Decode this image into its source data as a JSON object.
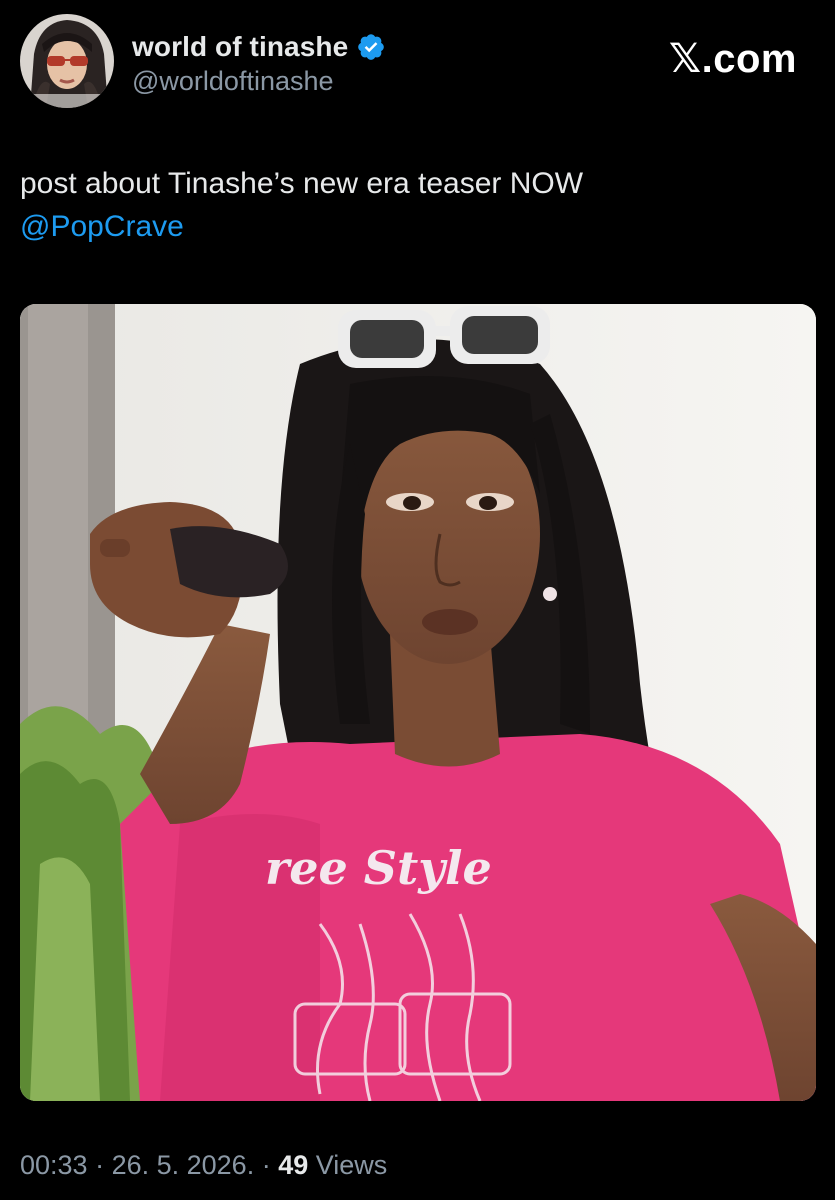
{
  "author": {
    "display_name": "world of tinashe",
    "handle": "@worldoftinashe",
    "verified": true,
    "avatar_icon": "avatar-photo"
  },
  "brand": {
    "label": "𝕏.com"
  },
  "tweet": {
    "text": "post about Tinashe’s new era teaser NOW",
    "mention": "@PopCrave"
  },
  "media": {
    "shirt_text": "ree Style"
  },
  "meta": {
    "time": "00:33",
    "separator1": " · ",
    "date": "26. 5. 2026.",
    "separator2": " · ",
    "views_count": "49",
    "views_label": " Views"
  },
  "colors": {
    "background": "#000000",
    "text_primary": "#e7e9ea",
    "text_secondary": "#8b98a5",
    "accent": "#1d9bf0"
  }
}
